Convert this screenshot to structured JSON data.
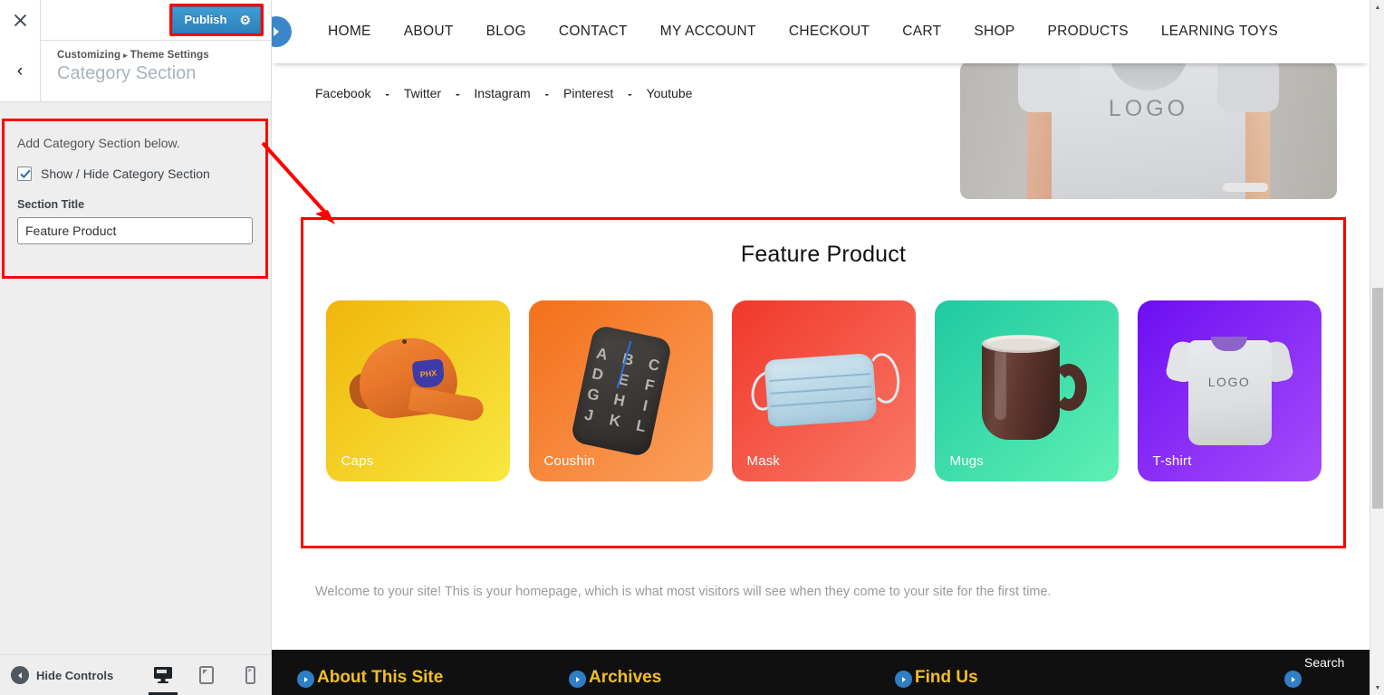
{
  "customizer": {
    "close_icon": "close-icon",
    "publish_label": "Publish",
    "gear_icon": "⚙",
    "back_icon": "‹",
    "breadcrumb_root": "Customizing",
    "breadcrumb_sep": "▸",
    "breadcrumb_parent": "Theme Settings",
    "panel_title": "Category Section",
    "section_description": "Add Category Section below.",
    "show_hide_label": "Show / Hide Category Section",
    "show_hide_checked": true,
    "field_label": "Section Title",
    "field_value": "Feature Product",
    "field_placeholder": "Section Title",
    "hide_controls_label": "Hide Controls",
    "devices": [
      {
        "name": "desktop",
        "active": true
      },
      {
        "name": "tablet",
        "active": false
      },
      {
        "name": "mobile",
        "active": false
      }
    ],
    "highlight_color": "#ff0000",
    "publish_color": "#2e82ba"
  },
  "site": {
    "nav": [
      "HOME",
      "ABOUT",
      "BLOG",
      "CONTACT",
      "MY ACCOUNT",
      "CHECKOUT",
      "CART",
      "SHOP",
      "PRODUCTS",
      "LEARNING TOYS"
    ],
    "social": [
      "Facebook",
      "Twitter",
      "Instagram",
      "Pinterest",
      "Youtube"
    ],
    "social_separator": "-",
    "hero_logo_text": "LOGO",
    "feature_section": {
      "title": "Feature Product",
      "cards": [
        {
          "label": "Caps",
          "art": "cap-icon",
          "from": "#f0b60c",
          "to": "#f8e83f"
        },
        {
          "label": "Coushin",
          "art": "cushion-icon",
          "from": "#f3701a",
          "to": "#fb9f5c"
        },
        {
          "label": "Mask",
          "art": "mask-icon",
          "from": "#f0382b",
          "to": "#fa7a68"
        },
        {
          "label": "Mugs",
          "art": "mug-icon",
          "from": "#20c9a0",
          "to": "#5df0b4"
        },
        {
          "label": "T-shirt",
          "art": "tshirt-icon",
          "from": "#6d0ef2",
          "to": "#a64cfb"
        }
      ]
    },
    "welcome_text": "Welcome to your site! This is your homepage, which is what most visitors will see when they come to your site for the first time.",
    "footer_columns": [
      {
        "title": "About This Site",
        "kind": "heading"
      },
      {
        "title": "Archives",
        "kind": "heading"
      },
      {
        "title": "Find Us",
        "kind": "heading"
      },
      {
        "title": "Search",
        "kind": "search"
      }
    ],
    "cushion_letters": [
      "A",
      "B",
      "C",
      "D",
      "E",
      "F",
      "G",
      "H",
      "I",
      "J",
      "K",
      "L"
    ]
  }
}
